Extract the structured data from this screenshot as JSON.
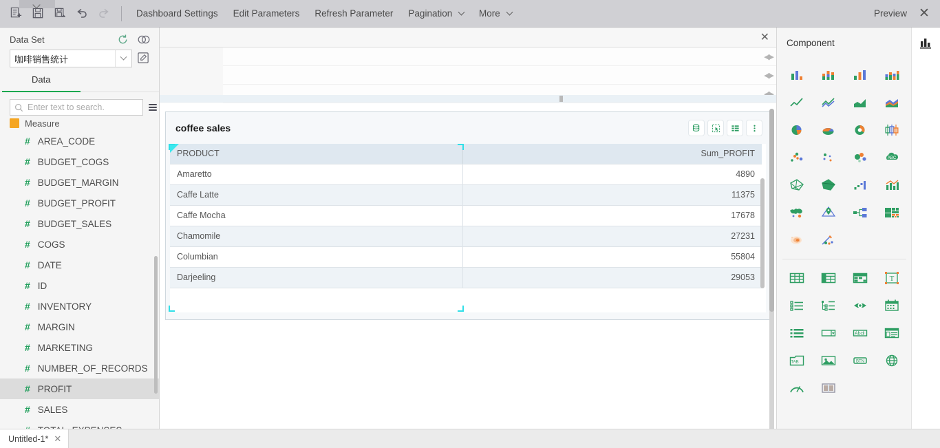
{
  "toolbar": {
    "icons": [
      {
        "name": "new-report-icon",
        "title": "New"
      },
      {
        "name": "save-icon",
        "title": "Save"
      },
      {
        "name": "save-as-icon",
        "title": "Save As"
      },
      {
        "name": "undo-icon",
        "title": "Undo"
      },
      {
        "name": "redo-icon",
        "title": "Redo"
      }
    ],
    "menus": [
      {
        "label": "Dashboard Settings",
        "caret": false
      },
      {
        "label": "Edit Parameters",
        "caret": false
      },
      {
        "label": "Refresh Parameter",
        "caret": false
      },
      {
        "label": "Pagination",
        "caret": true
      },
      {
        "label": "More",
        "caret": true
      }
    ],
    "preview_label": "Preview",
    "close_label": "✕"
  },
  "left_panel": {
    "dataset_title": "Data Set",
    "dataset_value": "咖啡销售统计",
    "refresh_icon": "refresh-icon",
    "link_icon": "relation-icon",
    "edit_icon": "edit-dataset-icon",
    "tab_data_label": "Data",
    "tab_underline_color": "#1aa84f",
    "search_placeholder": "Enter text to search.",
    "search_value": "",
    "group_label": "Measure",
    "group_color": "#f5a623",
    "fields": [
      {
        "label": "AREA_CODE",
        "selected": false
      },
      {
        "label": "BUDGET_COGS",
        "selected": false
      },
      {
        "label": "BUDGET_MARGIN",
        "selected": false
      },
      {
        "label": "BUDGET_PROFIT",
        "selected": false
      },
      {
        "label": "BUDGET_SALES",
        "selected": false
      },
      {
        "label": "COGS",
        "selected": false
      },
      {
        "label": "DATE",
        "selected": false
      },
      {
        "label": "ID",
        "selected": false
      },
      {
        "label": "INVENTORY",
        "selected": false
      },
      {
        "label": "MARGIN",
        "selected": false
      },
      {
        "label": "MARKETING",
        "selected": false
      },
      {
        "label": "NUMBER_OF_RECORDS",
        "selected": false
      },
      {
        "label": "PROFIT",
        "selected": true
      },
      {
        "label": "SALES",
        "selected": false
      },
      {
        "label": "TOTAL_EXPENSES",
        "selected": false
      }
    ],
    "field_icon": "#"
  },
  "top_panel": {
    "close_label": "✕",
    "rows": [
      {
        "handle": "resize-handle"
      },
      {
        "handle": "resize-handle"
      },
      {
        "handle": "resize-handle"
      }
    ]
  },
  "widget": {
    "title": "coffee sales",
    "tools": [
      {
        "name": "data-source-icon"
      },
      {
        "name": "select-area-icon"
      },
      {
        "name": "table-style-icon"
      },
      {
        "name": "more-options-icon"
      }
    ],
    "marker_color": "#3ce8ee",
    "selection_color": "#2fdfe8"
  },
  "chart_data": {
    "type": "table",
    "title": "coffee sales",
    "columns": [
      "PRODUCT",
      "Sum_PROFIT"
    ],
    "categories": [
      "Amaretto",
      "Caffe Latte",
      "Caffe Mocha",
      "Chamomile",
      "Columbian",
      "Darjeeling"
    ],
    "values": [
      4890,
      11375,
      17678,
      27231,
      55804,
      29053
    ],
    "rows": [
      {
        "PRODUCT": "Amaretto",
        "Sum_PROFIT": "4890"
      },
      {
        "PRODUCT": "Caffe Latte",
        "Sum_PROFIT": "11375"
      },
      {
        "PRODUCT": "Caffe Mocha",
        "Sum_PROFIT": "17678"
      },
      {
        "PRODUCT": "Chamomile",
        "Sum_PROFIT": "27231"
      },
      {
        "PRODUCT": "Columbian",
        "Sum_PROFIT": "55804"
      },
      {
        "PRODUCT": "Darjeeling",
        "Sum_PROFIT": "29053"
      }
    ],
    "xlabel": "PRODUCT",
    "ylabel": "Sum_PROFIT"
  },
  "right_panel": {
    "title": "Component",
    "collapse_icon": "arrow-right-circle-icon",
    "rail_icon": "chart-panel-icon",
    "group1": [
      "column-chart-icon",
      "stacked-column-chart-icon",
      "bar-chart-icon",
      "stacked-bar-chart-icon",
      "line-chart-icon",
      "multi-line-chart-icon",
      "area-chart-icon",
      "stacked-area-chart-icon",
      "pie-chart-icon",
      "pie-3d-chart-icon",
      "donut-chart-icon",
      "box-plot-icon",
      "scatter-chart-icon",
      "dot-plot-icon",
      "bubble-chart-icon",
      "word-cloud-icon",
      "radar-chart-icon",
      "filled-radar-chart-icon",
      "waterfall-chart-icon",
      "combo-chart-icon",
      "map-chart-icon",
      "point-map-icon",
      "tree-diagram-icon",
      "treemap-chart-icon",
      "heatmap-chart-icon",
      "custom-chart-icon"
    ],
    "group2": [
      "table-icon",
      "group-table-icon",
      "cross-table-icon",
      "text-component-icon",
      "list-view-icon",
      "tree-view-icon",
      "slider-icon",
      "calendar-icon",
      "list-box-icon",
      "dropdown-icon",
      "text-input-icon",
      "form-icon",
      "tab-container-icon",
      "image-icon",
      "button-icon",
      "web-frame-icon",
      "gauge-icon",
      "layout-panel-icon"
    ]
  },
  "bottom": {
    "doc_tab_label": "Untitled-1*",
    "doc_tab_close": "✕"
  }
}
